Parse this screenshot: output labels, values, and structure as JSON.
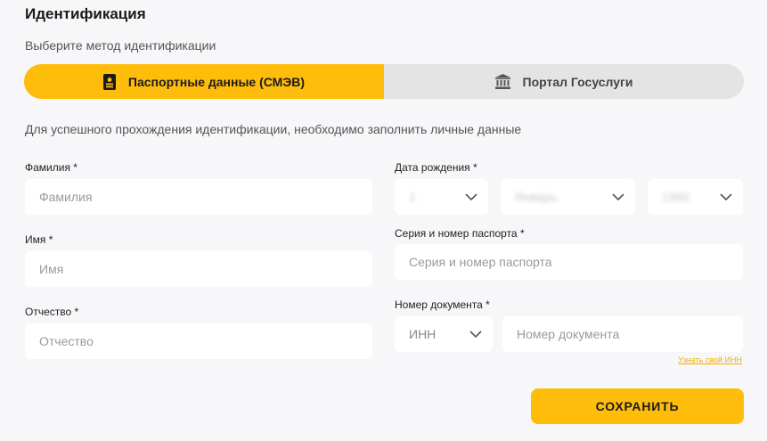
{
  "header": {
    "title": "Идентификация",
    "subtitle": "Выберите метод идентификации"
  },
  "methods": {
    "passport": {
      "label": "Паспортные данные (СМЭВ)",
      "icon": "id-card-icon",
      "active": true
    },
    "gosuslugi": {
      "label": "Портал Госуслуги",
      "icon": "bank-building-icon",
      "active": false
    }
  },
  "info_text": "Для успешного прохождения идентификации, необходимо заполнить личные данные",
  "form": {
    "surname": {
      "label": "Фамилия *",
      "placeholder": "Фамилия"
    },
    "name": {
      "label": "Имя *",
      "placeholder": "Имя"
    },
    "patronymic": {
      "label": "Отчество *",
      "placeholder": "Отчество"
    },
    "birthdate": {
      "label": "Дата рождения *",
      "day": "1",
      "month": "Январь",
      "year": "1990"
    },
    "passport": {
      "label": "Серия и номер паспорта *",
      "placeholder": "Серия и номер паспорта"
    },
    "document": {
      "label": "Номер документа *",
      "type": "ИНН",
      "placeholder": "Номер документа",
      "link": "Узнать свой ИНН"
    }
  },
  "save_label": "СОХРАНИТЬ",
  "colors": {
    "accent": "#ffbd0b",
    "background": "#f7f7fa",
    "segment_inactive": "#e4e4e4"
  }
}
